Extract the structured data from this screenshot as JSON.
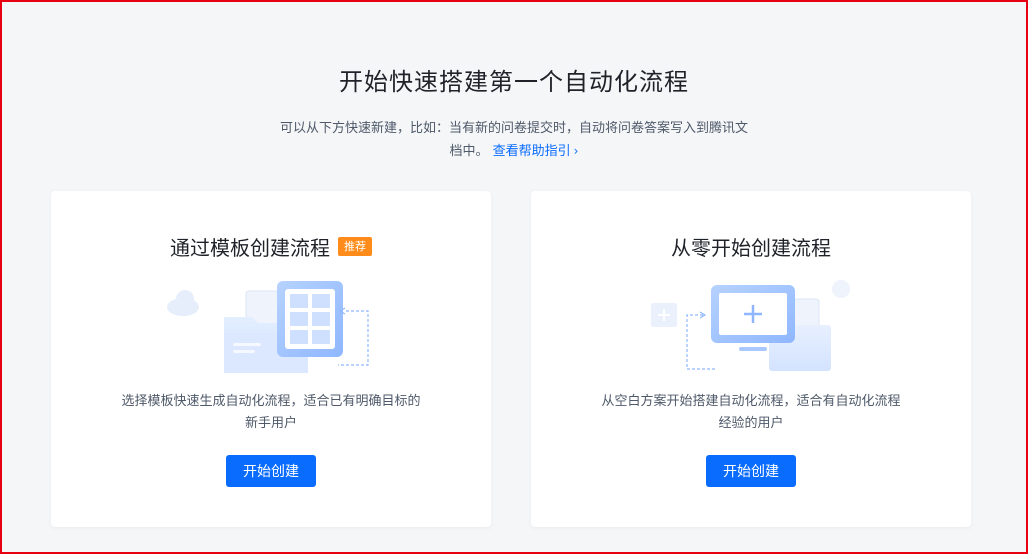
{
  "header": {
    "title": "开始快速搭建第一个自动化流程",
    "description": "可以从下方快速新建，比如：当有新的问卷提交时，自动将问卷答案写入到腾讯文档中。",
    "help_link": "查看帮助指引",
    "help_chevron": "›"
  },
  "cards": [
    {
      "title": "通过模板创建流程",
      "badge": "推荐",
      "description": "选择模板快速生成自动化流程，适合已有明确目标的新手用户",
      "button": "开始创建",
      "illustration": "template-illustration"
    },
    {
      "title": "从零开始创建流程",
      "description": "从空白方案开始搭建自动化流程，适合有自动化流程经验的用户",
      "button": "开始创建",
      "illustration": "blank-canvas-illustration"
    }
  ],
  "colors": {
    "accent": "#0a6cff",
    "badge": "#ff8c1a",
    "background": "#f5f6f8",
    "frame": "#e60012"
  }
}
